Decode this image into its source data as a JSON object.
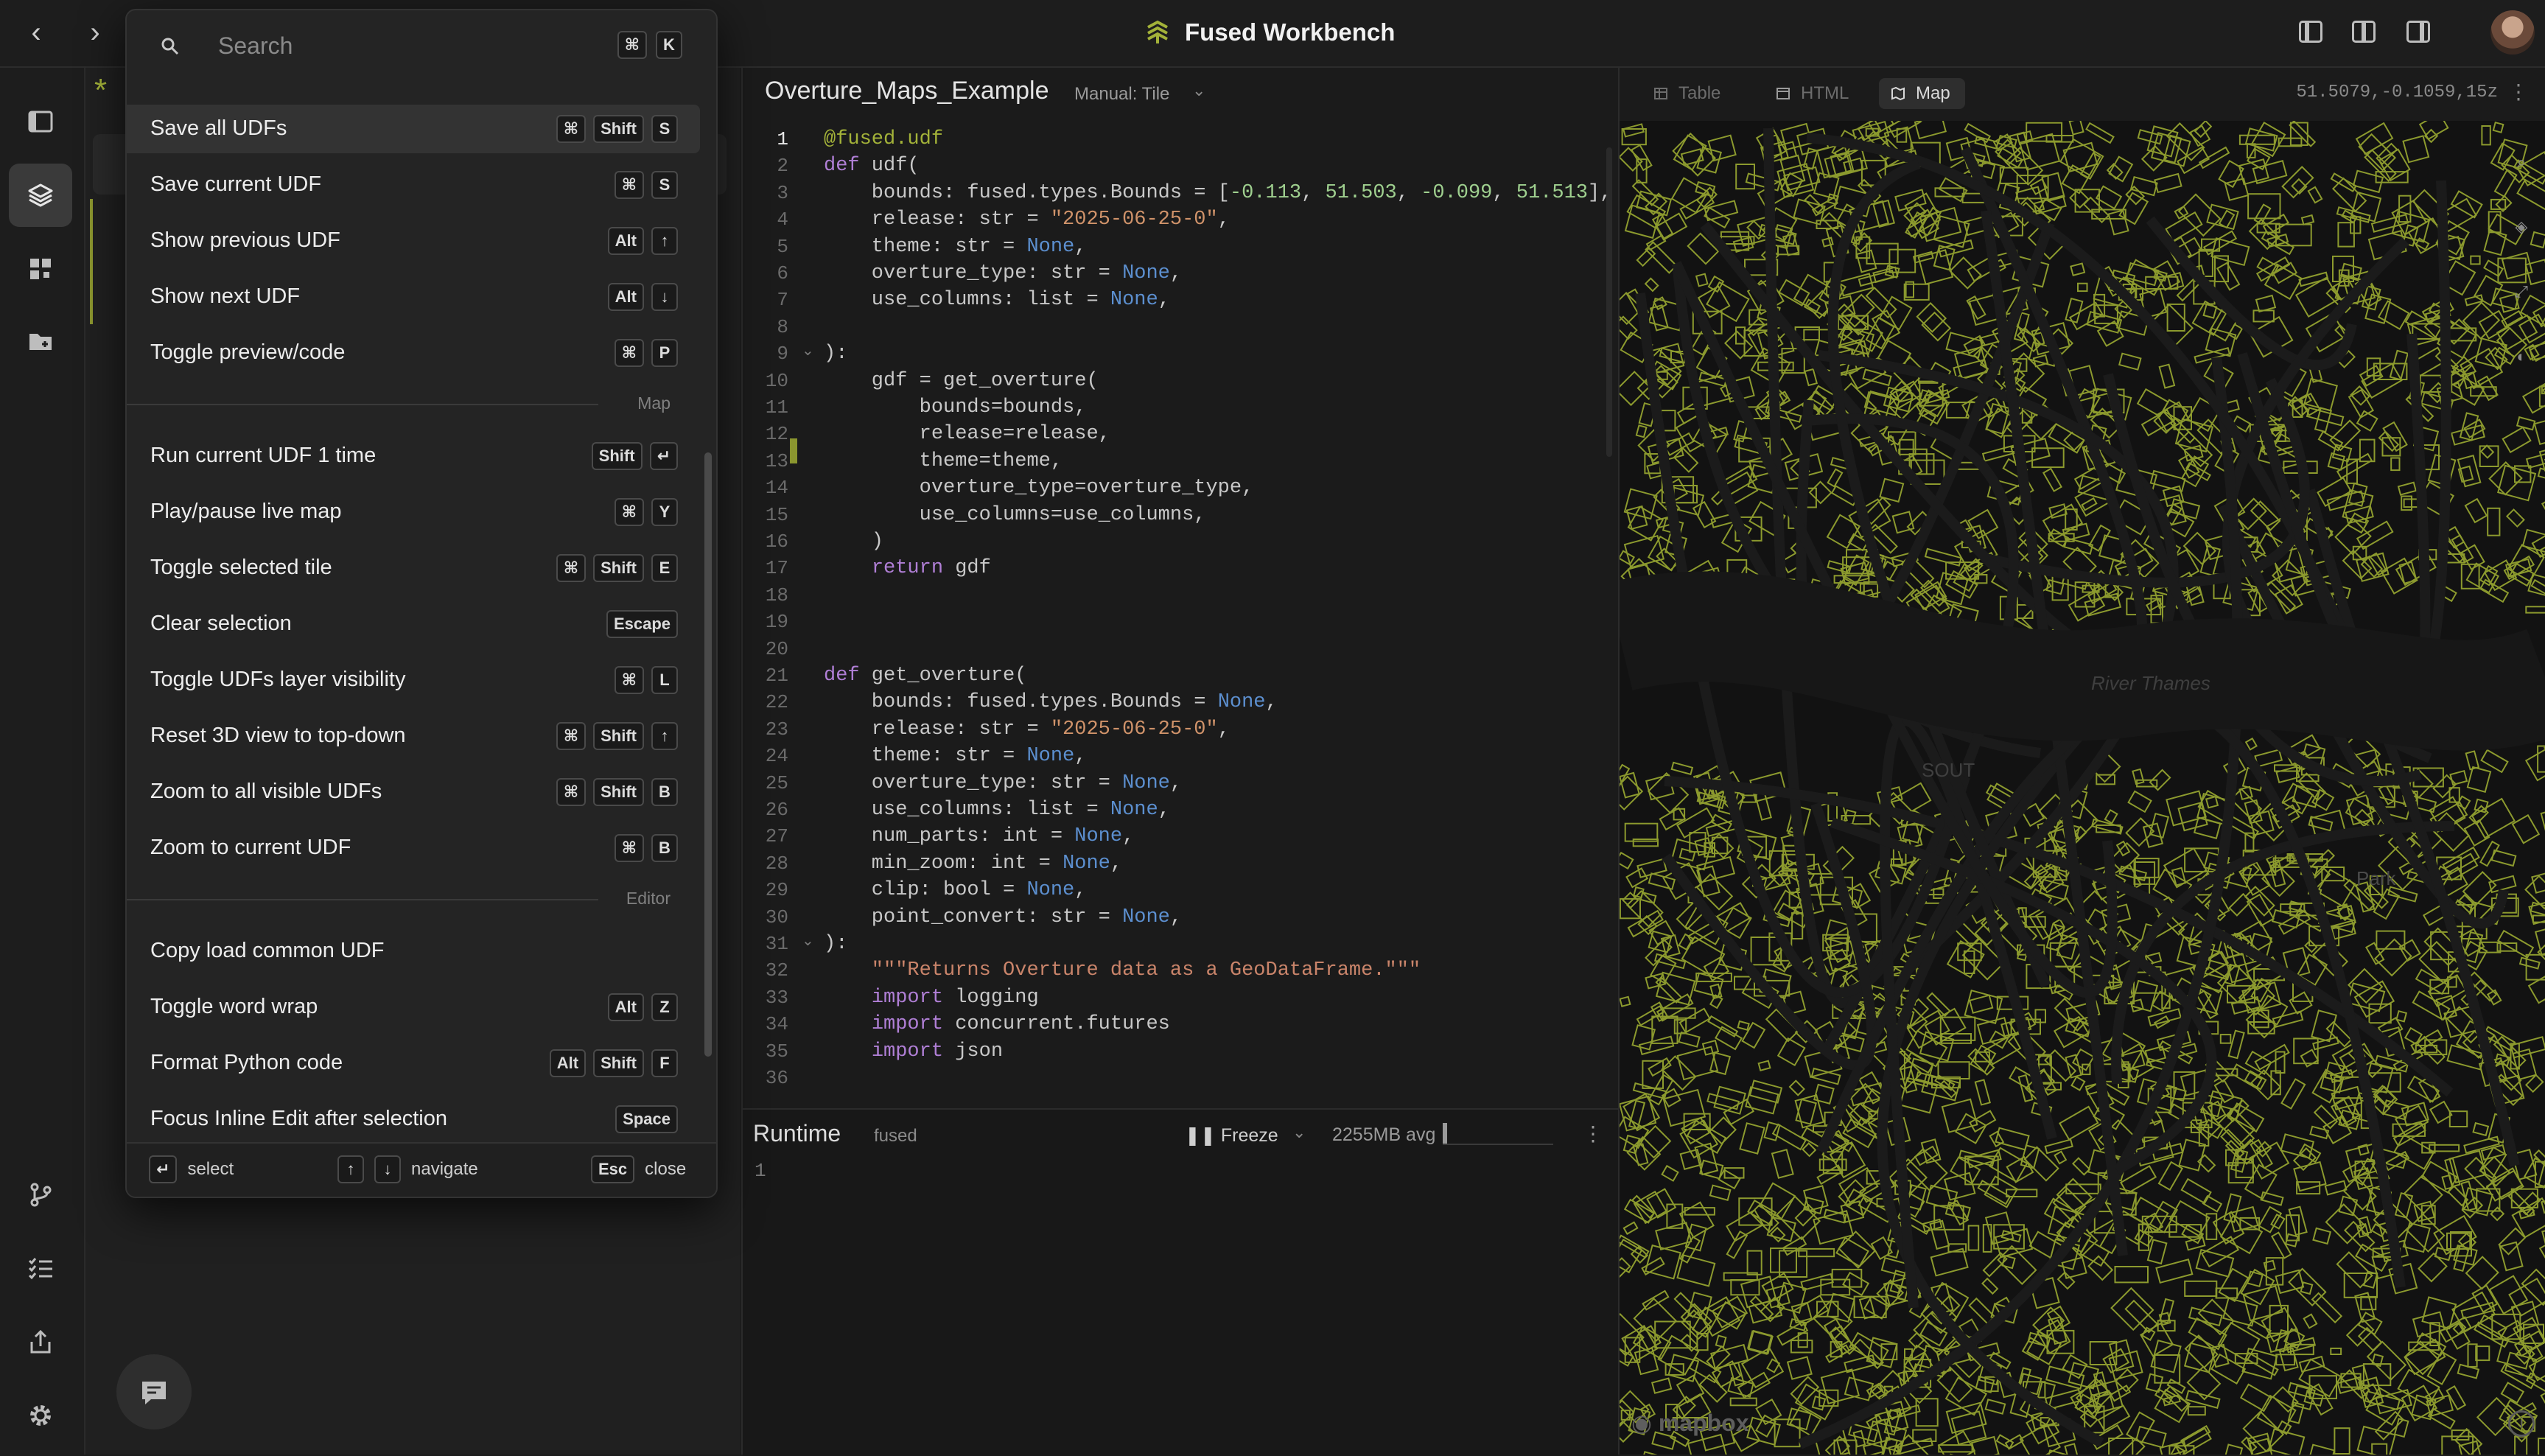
{
  "app": {
    "title": "Fused Workbench",
    "accent_color": "#a3b239"
  },
  "palette": {
    "search": {
      "placeholder": "Search",
      "shortcut": [
        "⌘",
        "K"
      ]
    },
    "items": [
      {
        "label": "Save all UDFs",
        "keys": [
          "⌘",
          "Shift",
          "S"
        ],
        "selected": true
      },
      {
        "label": "Save current UDF",
        "keys": [
          "⌘",
          "S"
        ]
      },
      {
        "label": "Show previous UDF",
        "keys": [
          "Alt",
          "↑"
        ]
      },
      {
        "label": "Show next UDF",
        "keys": [
          "Alt",
          "↓"
        ]
      },
      {
        "label": "Toggle preview/code",
        "keys": [
          "⌘",
          "P"
        ]
      },
      {
        "section": "Map"
      },
      {
        "label": "Run current UDF 1 time",
        "keys": [
          "Shift",
          "↵"
        ]
      },
      {
        "label": "Play/pause live map",
        "keys": [
          "⌘",
          "Y"
        ]
      },
      {
        "label": "Toggle selected tile",
        "keys": [
          "⌘",
          "Shift",
          "E"
        ]
      },
      {
        "label": "Clear selection",
        "keys": [
          "Escape"
        ]
      },
      {
        "label": "Toggle UDFs layer visibility",
        "keys": [
          "⌘",
          "L"
        ]
      },
      {
        "label": "Reset 3D view to top-down",
        "keys": [
          "⌘",
          "Shift",
          "↑"
        ]
      },
      {
        "label": "Zoom to all visible UDFs",
        "keys": [
          "⌘",
          "Shift",
          "B"
        ]
      },
      {
        "label": "Zoom to current UDF",
        "keys": [
          "⌘",
          "B"
        ]
      },
      {
        "section": "Editor"
      },
      {
        "label": "Copy load common UDF",
        "keys": []
      },
      {
        "label": "Toggle word wrap",
        "keys": [
          "Alt",
          "Z"
        ]
      },
      {
        "label": "Format Python code",
        "keys": [
          "Alt",
          "Shift",
          "F"
        ]
      },
      {
        "label": "Focus Inline Edit after selection",
        "keys": [
          "Space"
        ]
      }
    ],
    "footer": {
      "select_key": "↵",
      "select_label": "select",
      "nav_up": "↑",
      "nav_down": "↓",
      "navigate_label": "navigate",
      "close_key": "Esc",
      "close_label": "close"
    }
  },
  "editor": {
    "udf_name": "Overture_Maps_Example",
    "run_mode": "Manual: Tile",
    "current_line": 1,
    "lines": [
      "@fused.udf",
      "def udf(",
      "    bounds: fused.types.Bounds = [-0.113, 51.503, -0.099, 51.513],",
      "    release: str = \"2025-06-25-0\",",
      "    theme: str = None,",
      "    overture_type: str = None,",
      "    use_columns: list = None,",
      "",
      "):",
      "    gdf = get_overture(",
      "        bounds=bounds,",
      "        release=release,",
      "        theme=theme,",
      "        overture_type=overture_type,",
      "        use_columns=use_columns,",
      "    )",
      "    return gdf",
      "",
      "",
      "",
      "def get_overture(",
      "    bounds: fused.types.Bounds = None,",
      "    release: str = \"2025-06-25-0\",",
      "    theme: str = None,",
      "    overture_type: str = None,",
      "    use_columns: list = None,",
      "    num_parts: int = None,",
      "    min_zoom: int = None,",
      "    clip: bool = None,",
      "    point_convert: str = None,",
      "):",
      "    \"\"\"Returns Overture data as a GeoDataFrame.\"\"\"",
      "    import logging",
      "    import concurrent.futures",
      "    import json",
      ""
    ],
    "fold_lines": [
      9,
      31
    ]
  },
  "runtime": {
    "title": "Runtime",
    "env": "fused",
    "freeze_label": "Freeze",
    "memory": "2255MB avg",
    "memory_fraction": 0.04,
    "line_number": "1"
  },
  "map": {
    "tabs": [
      {
        "label": "Table",
        "icon": "table-icon",
        "active": false
      },
      {
        "label": "HTML",
        "icon": "html-icon",
        "active": false
      },
      {
        "label": "Map",
        "icon": "map-icon",
        "active": true
      }
    ],
    "coords": "51.5079,-0.1059,15z",
    "labels": {
      "river": "River Thames",
      "south": "SOUT",
      "ark": "Park"
    },
    "attribution": "mapbox",
    "building_color": "#8c9a2e"
  }
}
